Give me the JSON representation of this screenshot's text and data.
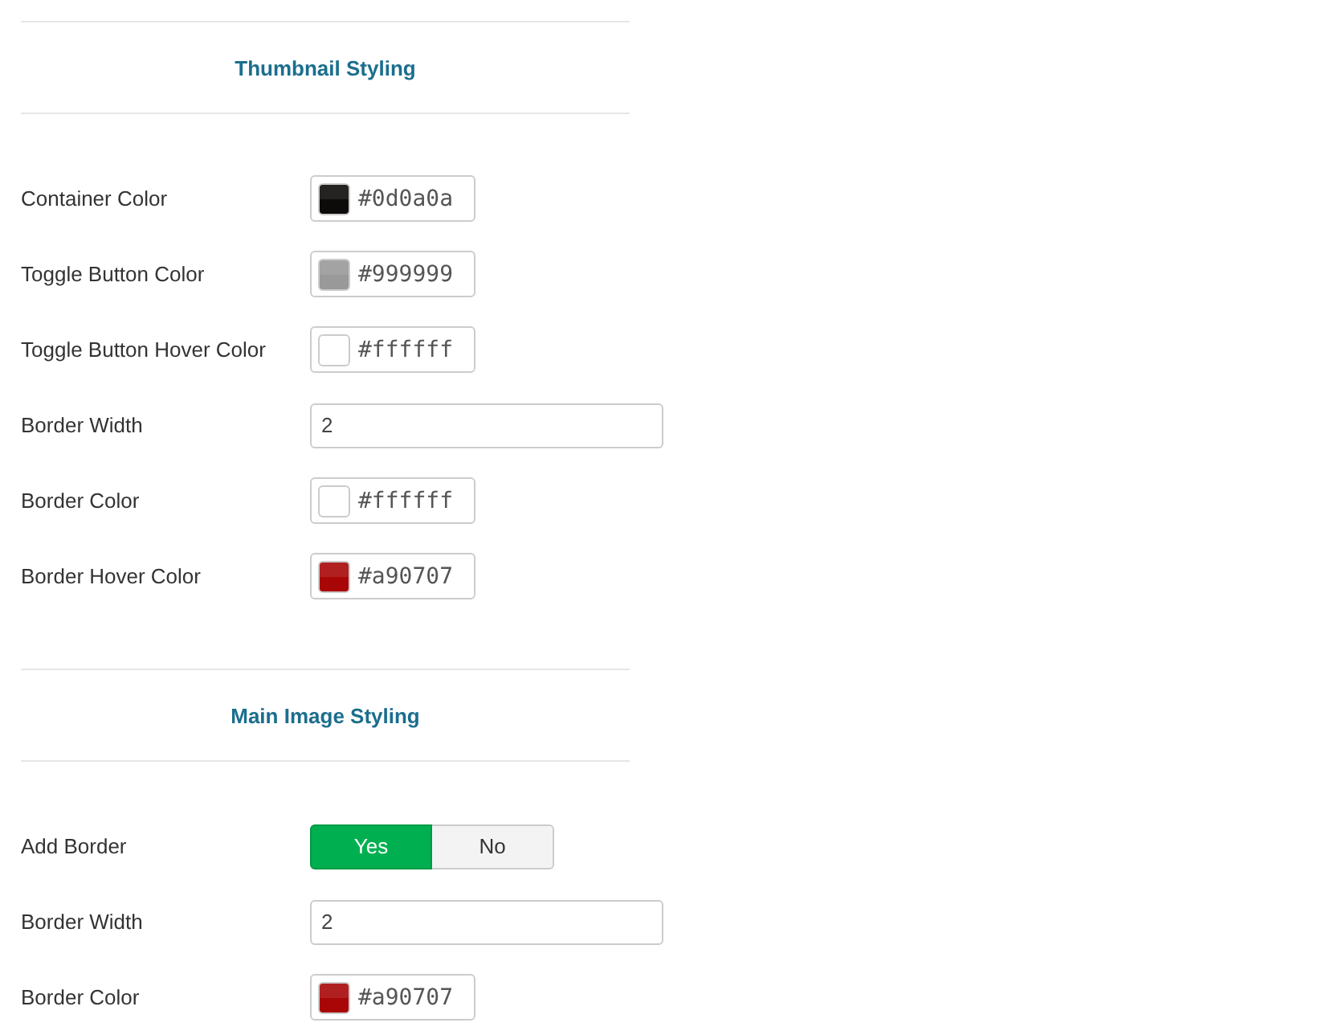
{
  "sections": [
    {
      "title": "Thumbnail Styling",
      "fields": [
        {
          "kind": "color",
          "label": "Container Color",
          "value": "#0d0a0a",
          "color": "#0d0a0a"
        },
        {
          "kind": "color",
          "label": "Toggle Button Color",
          "value": "#999999",
          "color": "#999999"
        },
        {
          "kind": "color",
          "label": "Toggle Button Hover Color",
          "value": "#ffffff",
          "color": "#ffffff"
        },
        {
          "kind": "text",
          "label": "Border Width",
          "value": "2"
        },
        {
          "kind": "color",
          "label": "Border Color",
          "value": "#ffffff",
          "color": "#ffffff"
        },
        {
          "kind": "color",
          "label": "Border Hover Color",
          "value": "#a90707",
          "color": "#a90707"
        }
      ]
    },
    {
      "title": "Main Image Styling",
      "fields": [
        {
          "kind": "toggle",
          "label": "Add Border",
          "options": [
            {
              "label": "Yes",
              "selected": true
            },
            {
              "label": "No",
              "selected": false
            }
          ]
        },
        {
          "kind": "text",
          "label": "Border Width",
          "value": "2"
        },
        {
          "kind": "color",
          "label": "Border Color",
          "value": "#a90707",
          "color": "#a90707"
        }
      ]
    }
  ]
}
